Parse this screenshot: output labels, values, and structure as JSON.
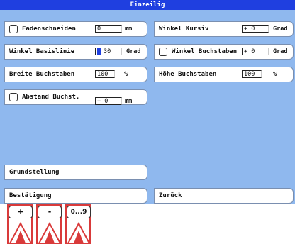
{
  "title": "Einzeilig",
  "left": {
    "fadenschneiden": {
      "label": "Fadenschneiden",
      "value": "0",
      "unit": "mm"
    },
    "winkel_basislinie": {
      "label": "Winkel Basislinie",
      "value": "30",
      "unit": "Grad"
    },
    "breite_buchstaben": {
      "label": "Breite Buchstaben",
      "value": "100",
      "unit": "%"
    },
    "abstand": {
      "label": "Abstand Buchst.",
      "value": "+ 0",
      "unit": "mm"
    },
    "grundstellung": {
      "label": "Grundstellung"
    },
    "bestaetigung": {
      "label": "Bestätigung"
    }
  },
  "right": {
    "winkel_kursiv": {
      "label": "Winkel Kursiv",
      "value": "+ 0",
      "unit": "Grad"
    },
    "winkel_buchstaben": {
      "label": "Winkel Buchstaben",
      "value": "+ 0",
      "unit": "Grad"
    },
    "hoehe_buchstaben": {
      "label": "Höhe Buchstaben",
      "value": "100",
      "unit": "%"
    },
    "zurueck": {
      "label": "Zurück"
    }
  },
  "keys": {
    "plus": "+",
    "minus": "-",
    "digits": "0...9"
  },
  "colors": {
    "title_bg": "#1f3fe0",
    "panel_bg": "#8fb8ee",
    "marker": "#d93a3a"
  }
}
